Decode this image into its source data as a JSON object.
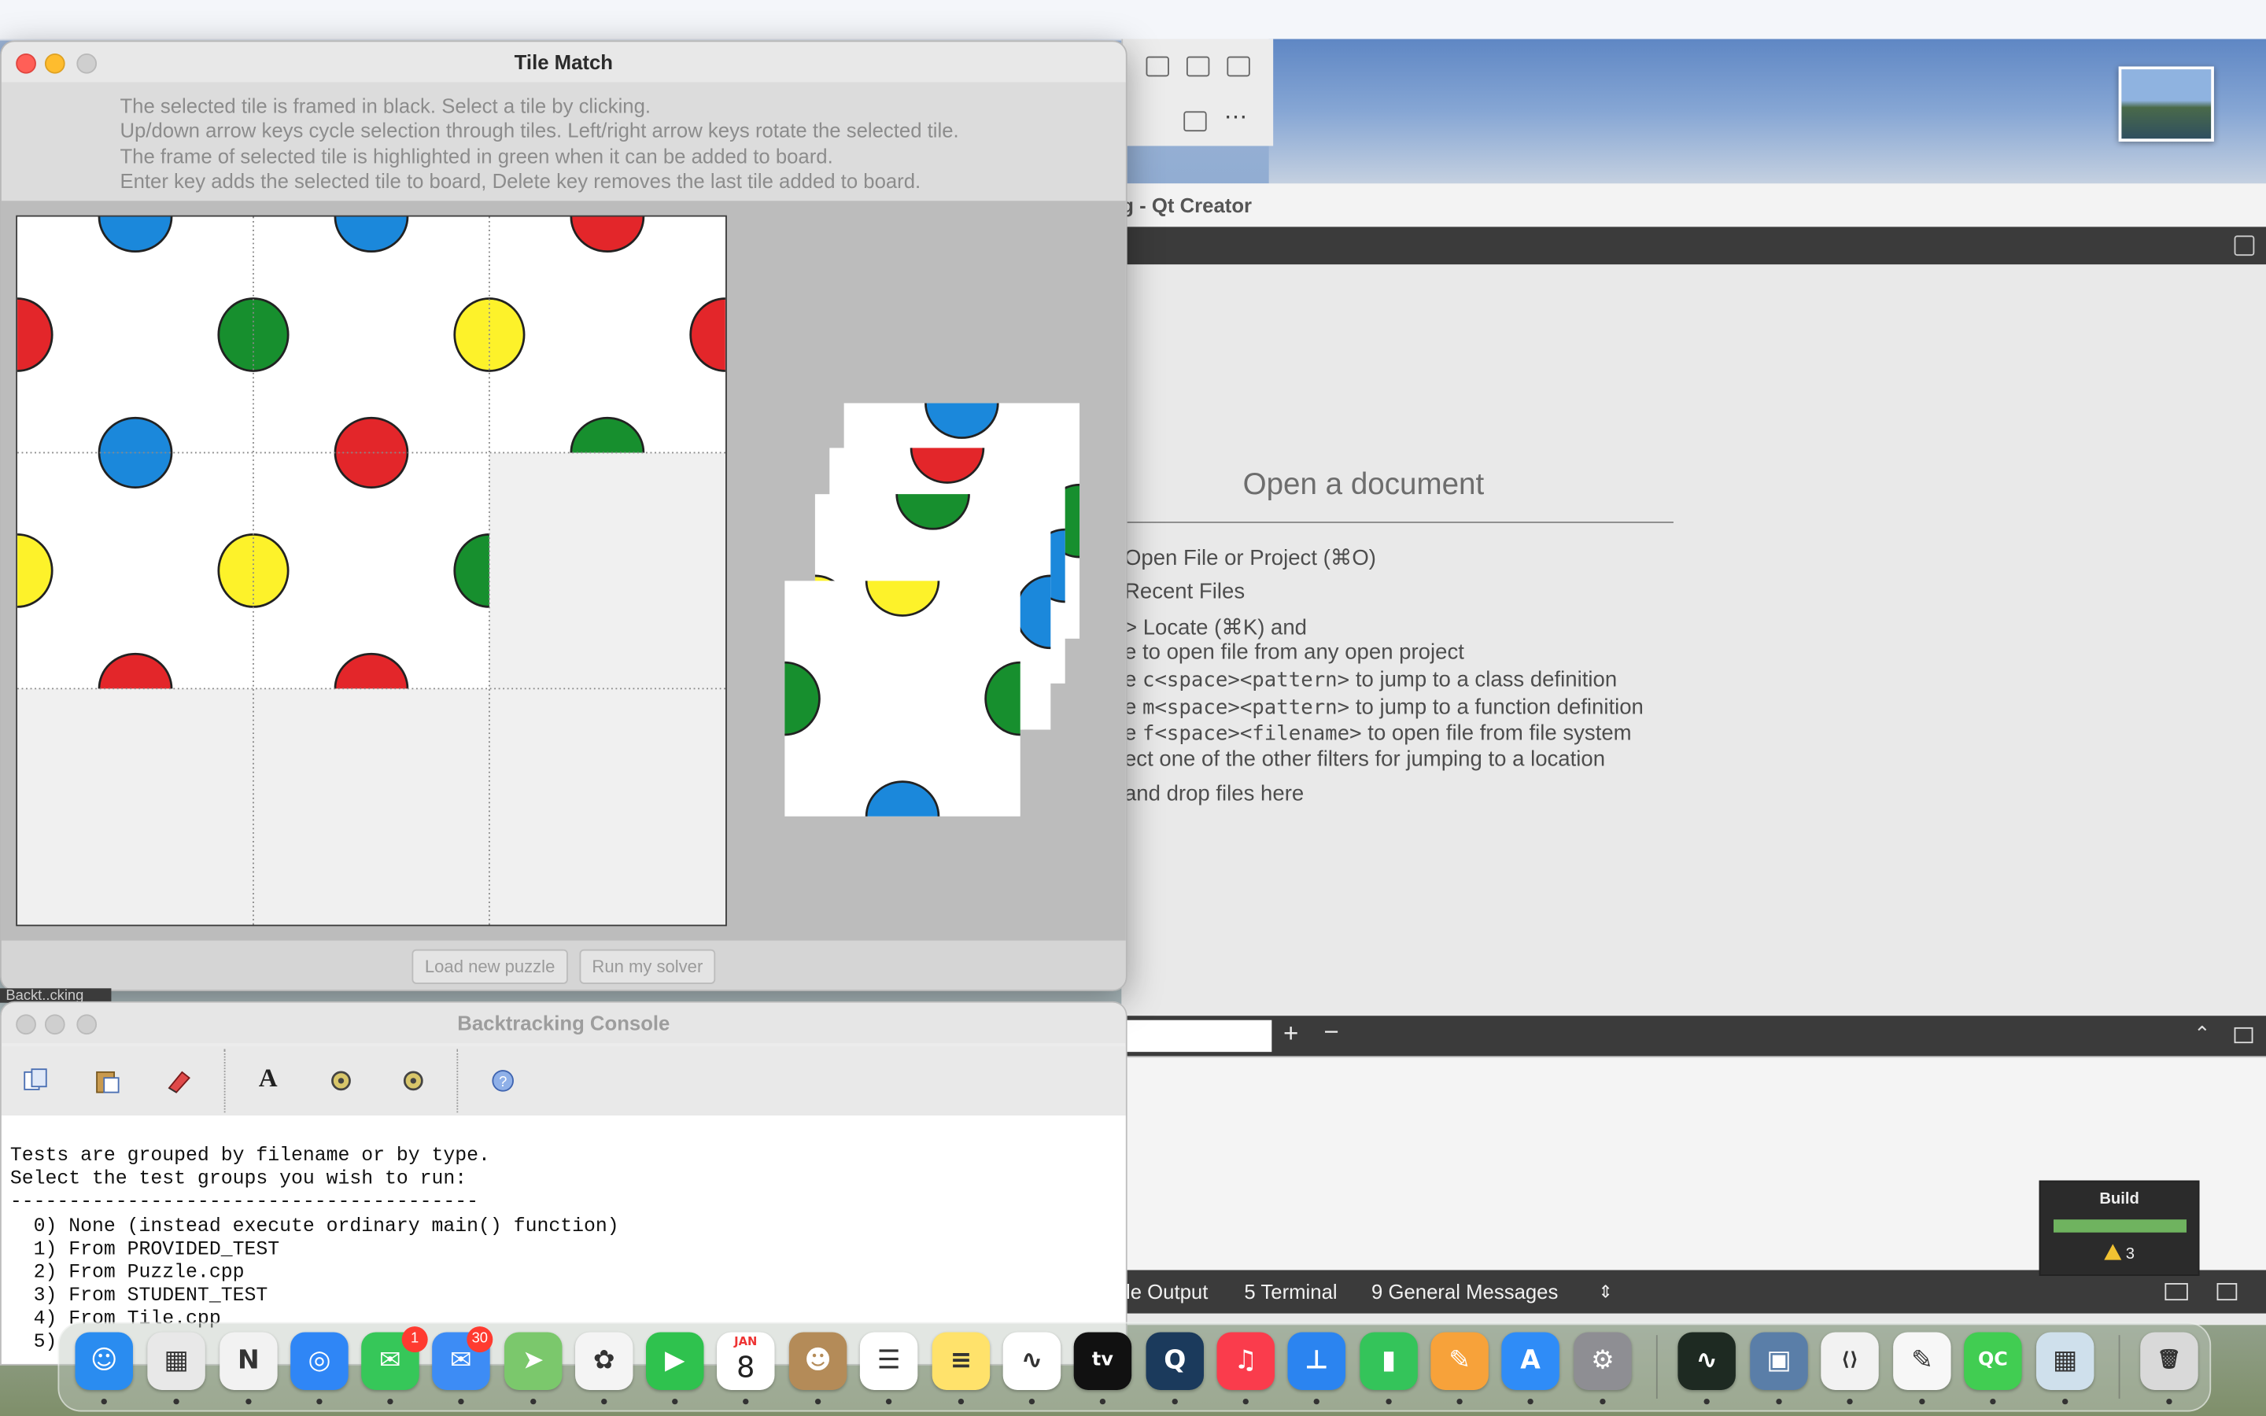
{
  "tile_match": {
    "title": "Tile Match",
    "instructions": [
      "The selected tile is framed in black. Select a tile by clicking.",
      "Up/down arrow keys cycle selection through tiles. Left/right arrow keys rotate the selected tile.",
      "The frame of selected tile is highlighted in green when it can be added to board.",
      "Enter key adds the selected tile to board, Delete key removes the last tile added to board."
    ],
    "buttons": {
      "load": "Load new puzzle",
      "run": "Run my solver"
    },
    "colors": {
      "red": "#e3262a",
      "green": "#178f2e",
      "blue": "#1b88db",
      "yellow": "#fdf22a",
      "gray": "#8a8a8a"
    }
  },
  "console": {
    "title": "Backtracking Console",
    "tab_label": "Backt..cking",
    "toolbar_icons": [
      "copy-icon",
      "paste-icon",
      "eraser-icon",
      "font-icon",
      "gear-icon",
      "gear-icon",
      "help-icon"
    ],
    "lines": [
      "Tests are grouped by filename or by type.",
      "Select the test groups you wish to run:",
      "----------------------------------------",
      "  0) None (instead execute ordinary main() function)",
      "  1) From PROVIDED_TEST",
      "  2) From Puzzle.cpp",
      "  3) From STUDENT_TEST",
      "  4) From Tile.cpp",
      "  5)"
    ]
  },
  "qt_creator": {
    "title": "g - Qt Creator",
    "open_document": "Open a document",
    "lines": [
      {
        "pre": "Open File or Project (⌘O)",
        "mono": "",
        "post": ""
      },
      {
        "pre": "Recent Files",
        "mono": "",
        "post": ""
      },
      {
        "pre": "> Locate (⌘K) and",
        "mono": "",
        "post": ""
      },
      {
        "pre": "e to open file from any open project",
        "mono": "",
        "post": ""
      },
      {
        "pre": "e ",
        "mono": "c<space><pattern>",
        "post": " to jump to a class definition"
      },
      {
        "pre": "e ",
        "mono": "m<space><pattern>",
        "post": " to jump to a function definition"
      },
      {
        "pre": "e ",
        "mono": "f<space><filename>",
        "post": " to open file from file system"
      },
      {
        "pre": "ect one of the other filters for jumping to a location",
        "mono": "",
        "post": ""
      },
      {
        "pre": "and drop files here",
        "mono": "",
        "post": ""
      }
    ],
    "status_items": [
      "ile Output",
      "5  Terminal",
      "9  General Messages"
    ],
    "build": {
      "label": "Build",
      "warnings": "3"
    }
  },
  "dock": {
    "apps": [
      {
        "name": "finder",
        "color": "#2a8cf0",
        "glyph": "☺"
      },
      {
        "name": "launchpad",
        "color": "#e8e8e8",
        "glyph": "▦"
      },
      {
        "name": "news",
        "color": "#f2f2f2",
        "glyph": "N"
      },
      {
        "name": "safari",
        "color": "#2f86f6",
        "glyph": "◎"
      },
      {
        "name": "messages",
        "color": "#36c759",
        "glyph": "✉",
        "badge": "1"
      },
      {
        "name": "mail",
        "color": "#3d8cf5",
        "glyph": "✉",
        "badge": "30"
      },
      {
        "name": "maps",
        "color": "#7bc86c",
        "glyph": "➤"
      },
      {
        "name": "photos",
        "color": "#f4f4f4",
        "glyph": "✿"
      },
      {
        "name": "facetime",
        "color": "#2fc24e",
        "glyph": "▶"
      },
      {
        "name": "calendar",
        "color": "#ffffff",
        "glyph": "8",
        "month": "JAN"
      },
      {
        "name": "contacts",
        "color": "#b48b58",
        "glyph": "☻"
      },
      {
        "name": "reminders",
        "color": "#ffffff",
        "glyph": "☰"
      },
      {
        "name": "notes",
        "color": "#ffe26b",
        "glyph": "≡"
      },
      {
        "name": "freeform",
        "color": "#ffffff",
        "glyph": "∿"
      },
      {
        "name": "tv",
        "color": "#111111",
        "glyph": "tv"
      },
      {
        "name": "quicktime",
        "color": "#1b3a5c",
        "glyph": "Q"
      },
      {
        "name": "music",
        "color": "#fa3c4c",
        "glyph": "♫"
      },
      {
        "name": "keynote",
        "color": "#2b84f0",
        "glyph": "⊥"
      },
      {
        "name": "numbers",
        "color": "#34c45a",
        "glyph": "▮"
      },
      {
        "name": "pages",
        "color": "#f7a23a",
        "glyph": "✎"
      },
      {
        "name": "app-store",
        "color": "#2f8cf7",
        "glyph": "A"
      },
      {
        "name": "system-settings",
        "color": "#8e8e93",
        "glyph": "⚙"
      },
      {
        "name": "activity-monitor",
        "color": "#1e2a22",
        "glyph": "∿"
      },
      {
        "name": "preview",
        "color": "#5a7ea8",
        "glyph": "▣"
      },
      {
        "name": "vscode",
        "color": "#f2f2f2",
        "glyph": "⟨⟩"
      },
      {
        "name": "textedit",
        "color": "#f7f7f7",
        "glyph": "✎"
      },
      {
        "name": "qt-creator",
        "color": "#41cd52",
        "glyph": "QC"
      },
      {
        "name": "grapher",
        "color": "#cfe0ec",
        "glyph": "▦"
      },
      {
        "name": "trash",
        "color": "#d9d9d9",
        "glyph": "🗑"
      }
    ]
  }
}
